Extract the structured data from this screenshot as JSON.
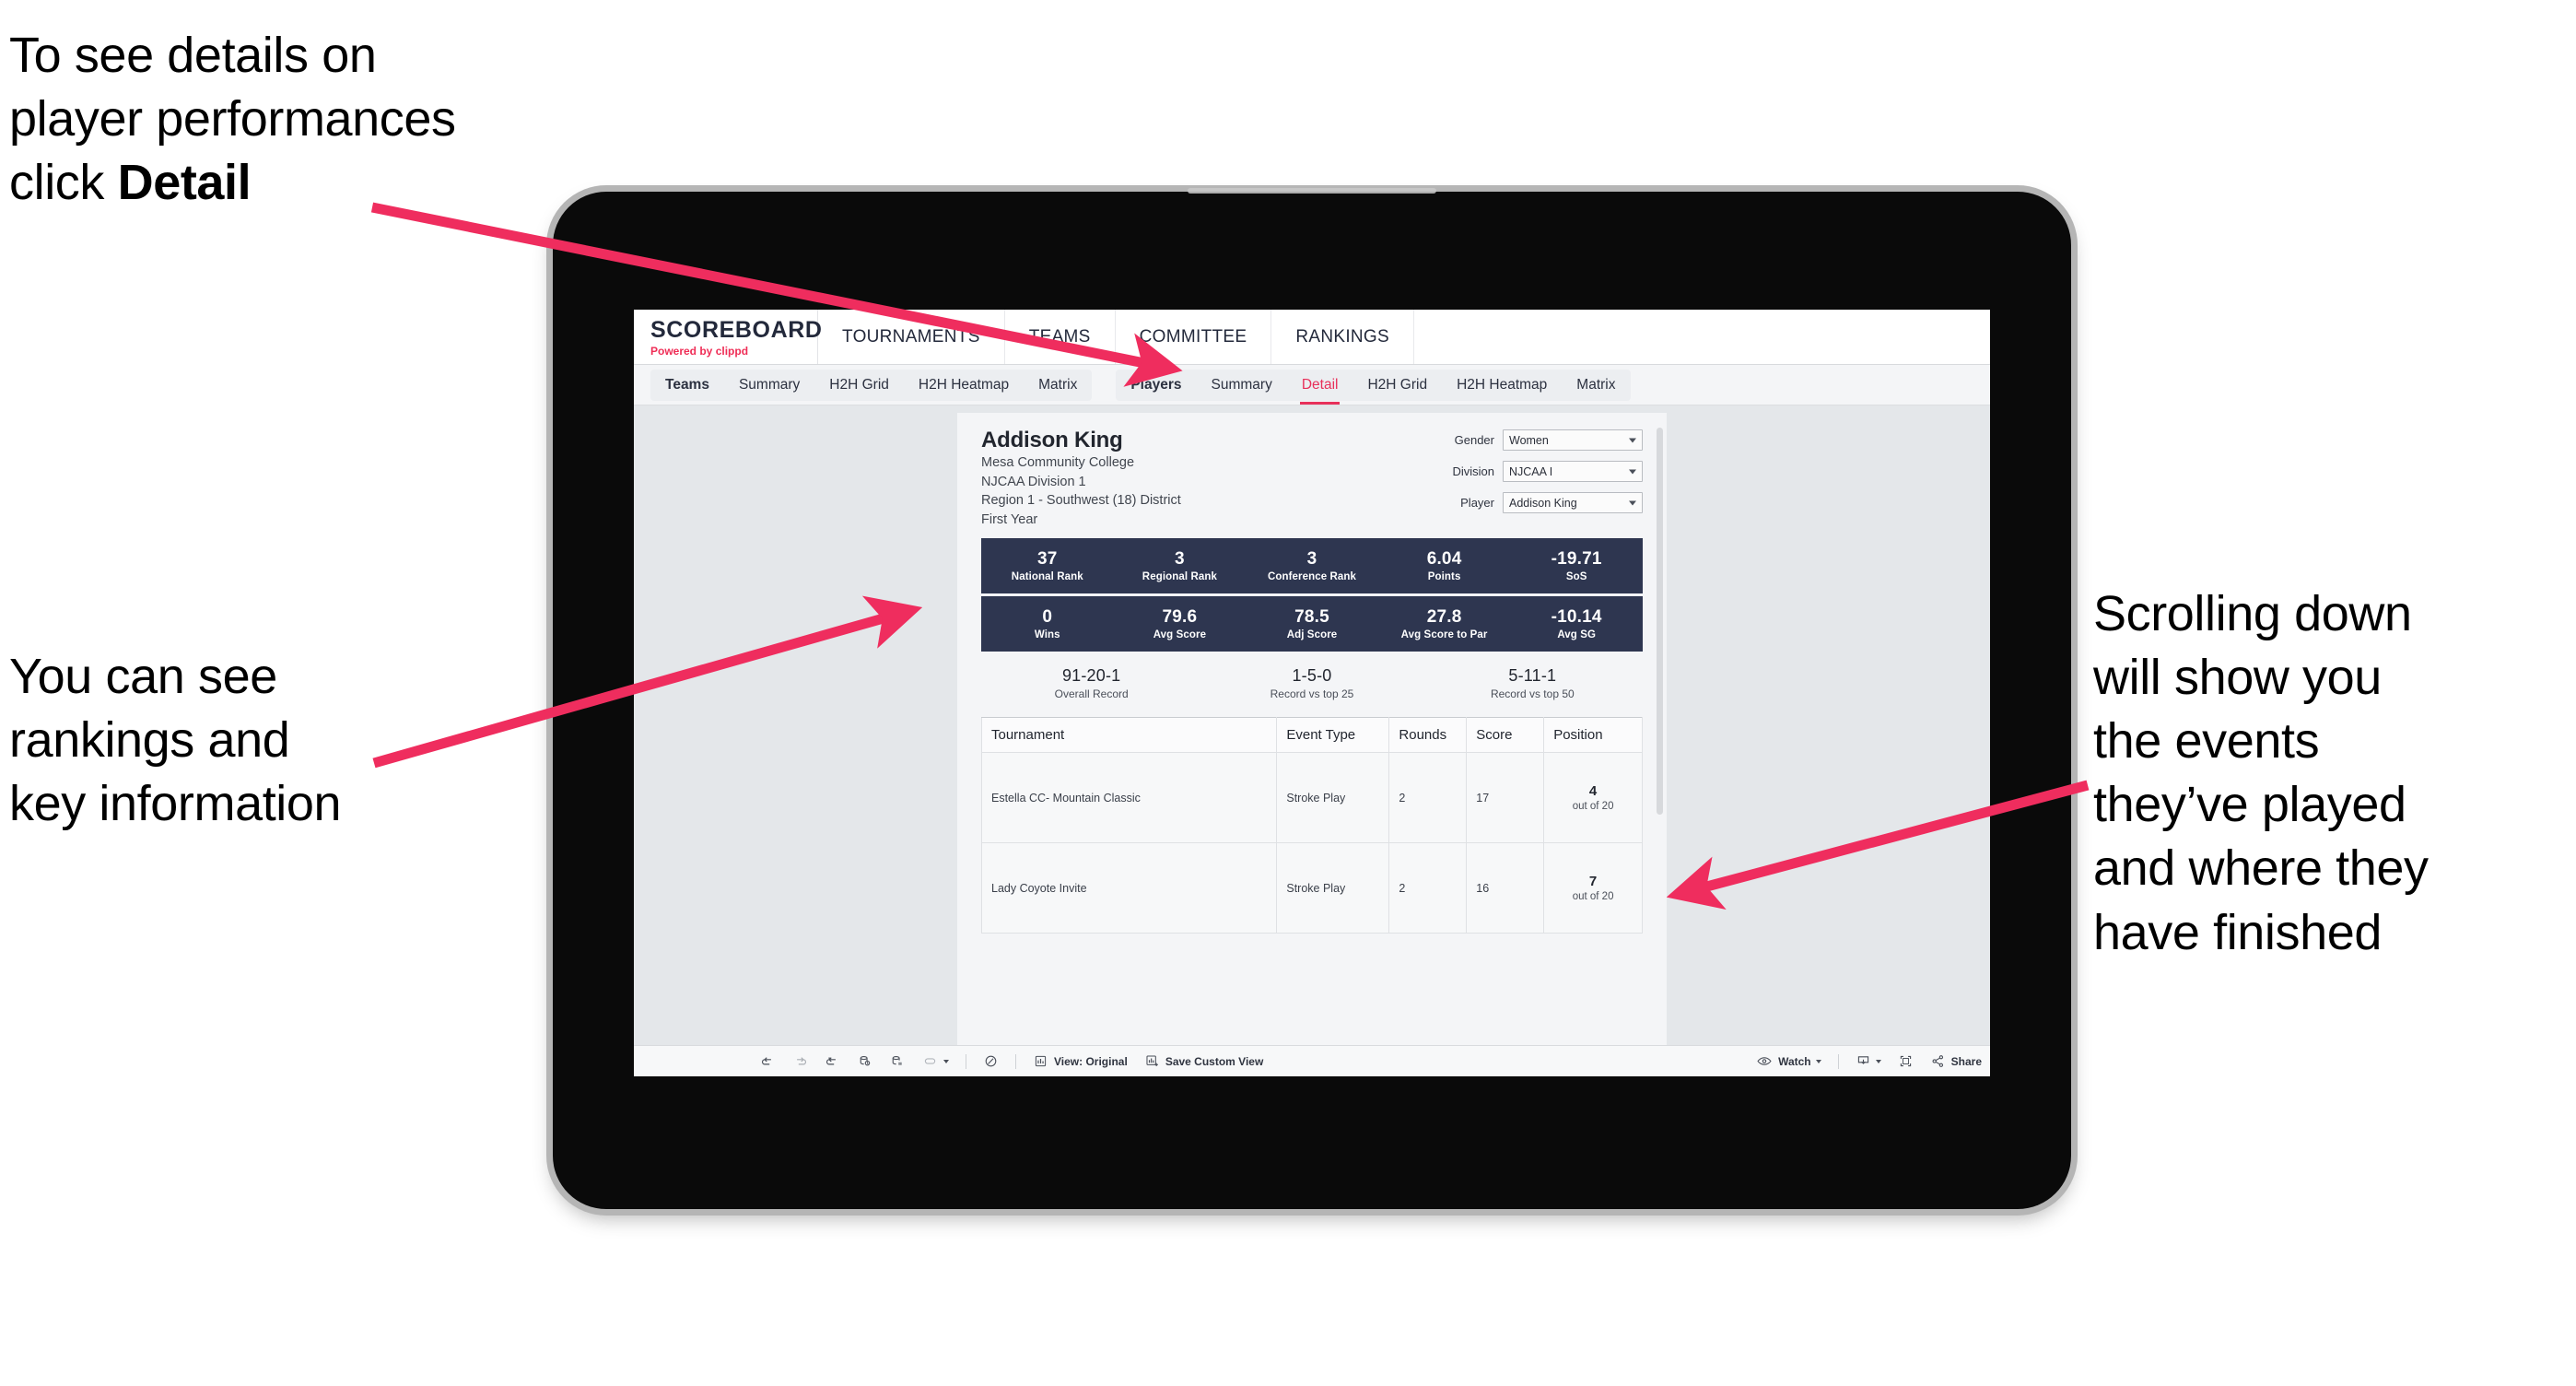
{
  "annotations": {
    "top_left": "To see details on\nplayer performances\nclick ",
    "top_left_bold": "Detail",
    "left": "You can see\nrankings and\nkey information",
    "right": "Scrolling down\nwill show you\nthe events\nthey’ve played\nand where they\nhave finished"
  },
  "app": {
    "brand_name": "SCOREBOARD",
    "brand_sub_prefix": "Powered by ",
    "brand_sub_accent": "clippd",
    "accent_color": "#e8305a",
    "navy_color": "#2e3650",
    "top_nav": [
      "TOURNAMENTS",
      "TEAMS",
      "COMMITTEE",
      "RANKINGS"
    ],
    "sub_nav_teams": [
      "Teams",
      "Summary",
      "H2H Grid",
      "H2H Heatmap",
      "Matrix"
    ],
    "sub_nav_players": [
      "Players",
      "Summary",
      "Detail",
      "H2H Grid",
      "H2H Heatmap",
      "Matrix"
    ],
    "sub_nav_active": "Detail"
  },
  "player": {
    "name": "Addison King",
    "college": "Mesa Community College",
    "division": "NJCAA Division 1",
    "region": "Region 1 - Southwest (18) District",
    "year": "First Year"
  },
  "filters": [
    {
      "label": "Gender",
      "value": "Women"
    },
    {
      "label": "Division",
      "value": "NJCAA I"
    },
    {
      "label": "Player",
      "value": "Addison King"
    }
  ],
  "stats_row1": [
    {
      "value": "37",
      "label": "National Rank"
    },
    {
      "value": "3",
      "label": "Regional Rank"
    },
    {
      "value": "3",
      "label": "Conference Rank"
    },
    {
      "value": "6.04",
      "label": "Points"
    },
    {
      "value": "-19.71",
      "label": "SoS"
    }
  ],
  "stats_row2": [
    {
      "value": "0",
      "label": "Wins"
    },
    {
      "value": "79.6",
      "label": "Avg Score"
    },
    {
      "value": "78.5",
      "label": "Adj Score"
    },
    {
      "value": "27.8",
      "label": "Avg Score to Par"
    },
    {
      "value": "-10.14",
      "label": "Avg SG"
    }
  ],
  "records": [
    {
      "value": "91-20-1",
      "label": "Overall Record"
    },
    {
      "value": "1-5-0",
      "label": "Record vs top 25"
    },
    {
      "value": "5-11-1",
      "label": "Record vs top 50"
    }
  ],
  "table": {
    "headers": [
      "Tournament",
      "Event Type",
      "Rounds",
      "Score",
      "Position"
    ],
    "rows": [
      {
        "tournament": "Estella CC- Mountain Classic",
        "event_type": "Stroke Play",
        "rounds": "2",
        "score": "17",
        "position": "4",
        "position_out_of": "out of 20"
      },
      {
        "tournament": "Lady Coyote Invite",
        "event_type": "Stroke Play",
        "rounds": "2",
        "score": "16",
        "position": "7",
        "position_out_of": "out of 20"
      }
    ]
  },
  "toolbar": {
    "view_label": "View: Original",
    "save_label": "Save Custom View",
    "watch_label": "Watch",
    "share_label": "Share"
  }
}
